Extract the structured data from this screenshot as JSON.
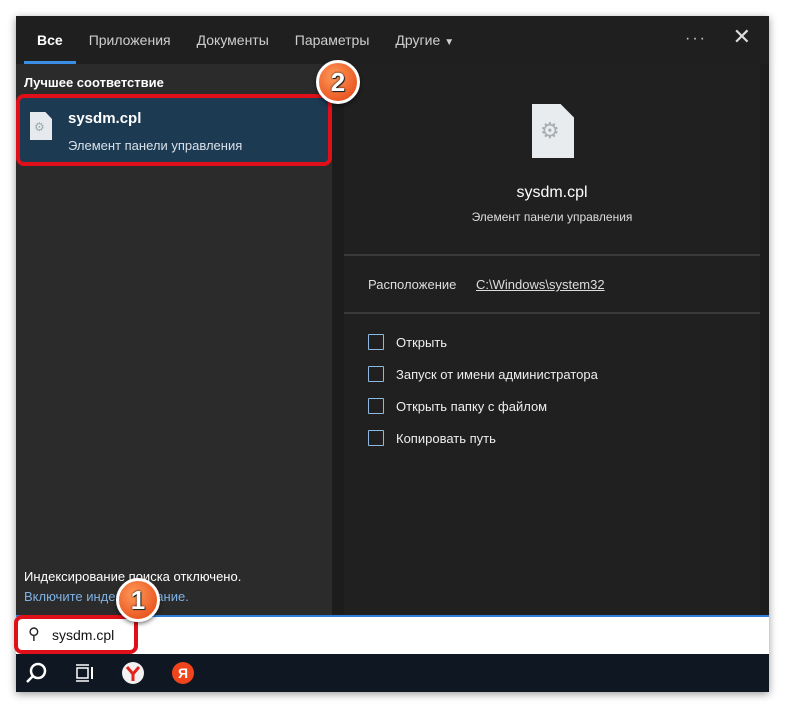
{
  "tabs": [
    {
      "label": "Все",
      "active": true
    },
    {
      "label": "Приложения"
    },
    {
      "label": "Документы"
    },
    {
      "label": "Параметры"
    },
    {
      "label": "Другие"
    }
  ],
  "more_label": "···",
  "close_label": "✕",
  "best_match": {
    "heading": "Лучшее соответствие",
    "title": "sysdm.cpl",
    "subtitle": "Элемент панели управления"
  },
  "indexing": {
    "message": "Индексирование поиска отключено.",
    "link": "Включите индексирование."
  },
  "detail": {
    "title": "sysdm.cpl",
    "subtitle": "Элемент панели управления",
    "location_label": "Расположение",
    "location_value": "C:\\Windows\\system32",
    "actions": [
      {
        "label": "Открыть",
        "icon": "open-icon"
      },
      {
        "label": "Запуск от имени администратора",
        "icon": "admin-shield-icon"
      },
      {
        "label": "Открыть папку с файлом",
        "icon": "folder-icon"
      },
      {
        "label": "Копировать путь",
        "icon": "copy-icon"
      }
    ]
  },
  "search": {
    "value": "sysdm.cpl"
  },
  "annotations": [
    "1",
    "2"
  ],
  "colors": {
    "accent": "#2f7fd8",
    "highlight": "#e0101a",
    "selected": "#1d3a53"
  }
}
